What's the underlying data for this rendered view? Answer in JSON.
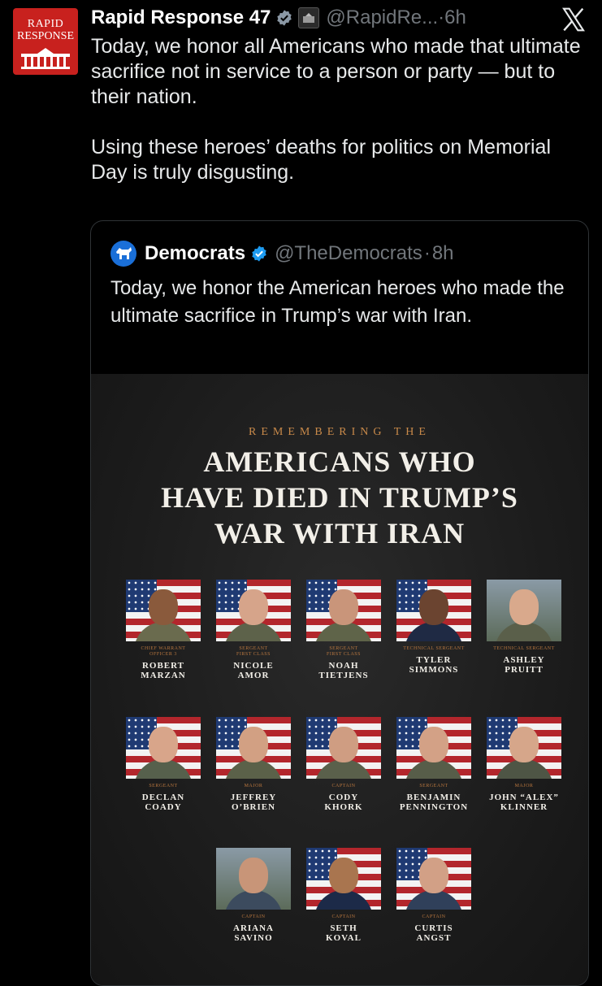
{
  "tweet": {
    "avatar_line1": "RAPID",
    "avatar_line2": "RESPONSE",
    "name": "Rapid Response 47",
    "affiliate_badge": "THE WHITE HOUSE",
    "handle": "@RapidRe...",
    "separator": " · ",
    "time": "6h",
    "text": "Today, we honor all Americans who made that ultimate sacrifice not in service to a person or party — but to their nation.\n\nUsing these heroes’ deaths for politics on Memorial Day is truly disgusting."
  },
  "quote": {
    "name": "Democrats",
    "handle": "@TheDemocrats",
    "separator": "·",
    "time": "8h",
    "text": "Today, we honor the American heroes who made the ultimate sacrifice in Trump’s war with Iran."
  },
  "graphic": {
    "kicker": "REMEMBERING THE",
    "headline": "AMERICANS WHO\nHAVE DIED IN TRUMP’S\nWAR WITH IRAN",
    "people": [
      {
        "rank": "CHIEF WARRANT\nOFFICER 3",
        "name": "ROBERT\nMARZAN"
      },
      {
        "rank": "SERGEANT\nFIRST CLASS",
        "name": "NICOLE\nAMOR"
      },
      {
        "rank": "SERGEANT\nFIRST CLASS",
        "name": "NOAH\nTIETJENS"
      },
      {
        "rank": "TECHNICAL SERGEANT",
        "name": "TYLER\nSIMMONS"
      },
      {
        "rank": "TECHNICAL SERGEANT",
        "name": "ASHLEY\nPRUITT"
      },
      {
        "rank": "SERGEANT",
        "name": "DECLAN\nCOADY"
      },
      {
        "rank": "MAJOR",
        "name": "JEFFREY\nO’BRIEN"
      },
      {
        "rank": "CAPTAIN",
        "name": "CODY\nKHORK"
      },
      {
        "rank": "SERGEANT",
        "name": "BENJAMIN\nPENNINGTON"
      },
      {
        "rank": "MAJOR",
        "name": "JOHN “ALEX”\nKLINNER"
      },
      {
        "rank": "CAPTAIN",
        "name": "ARIANA\nSAVINO"
      },
      {
        "rank": "CAPTAIN",
        "name": "SETH\nKOVAL"
      },
      {
        "rank": "CAPTAIN",
        "name": "CURTIS\nANGST"
      }
    ]
  },
  "colors": {
    "background": "#000000",
    "text": "#e7e9ea",
    "muted": "#71767b",
    "verified": "#1d9bf0",
    "accent_rank": "#b9773f"
  }
}
